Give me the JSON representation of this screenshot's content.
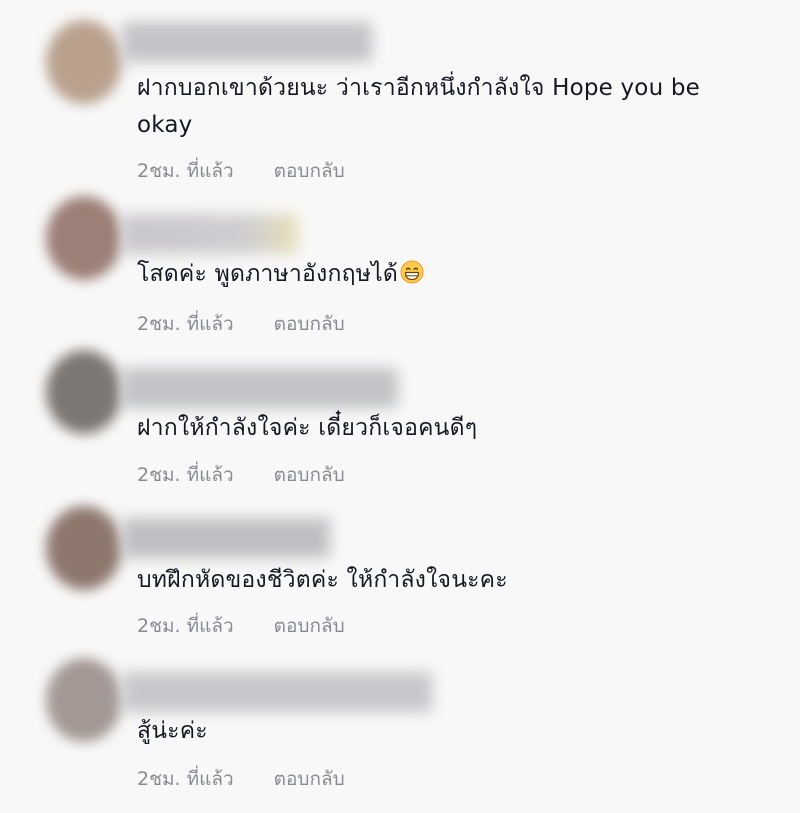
{
  "comments": [
    {
      "text": "ฝากบอกเขาด้วยนะ ว่าเราอีกหนึ่งกำลังใจ Hope you be okay",
      "time": "2ชม. ที่แล้ว",
      "reply": "ตอบกลับ",
      "avatar_color": "#b9a18e",
      "name_color": "#c4c4c8"
    },
    {
      "text": "โสดค่ะ พูดภาษาอังกฤษได้",
      "emoji": "grinning-face-emoji",
      "time": "2ชม. ที่แล้ว",
      "reply": "ตอบกลับ",
      "avatar_color": "#9c7f76",
      "name_color": "#c9c7cc"
    },
    {
      "text": "ฝากให้กำลังใจค่ะ เดี๋ยวก็เจอคนดีๆ",
      "time": "2ชม. ที่แล้ว",
      "reply": "ตอบกลับ",
      "avatar_color": "#7e7874",
      "name_color": "#c2c3c6"
    },
    {
      "text": "บทฝึกหัดของชีวิตค่ะ ให้กำลังใจนะคะ",
      "time": "2ชม. ที่แล้ว",
      "reply": "ตอบกลับ",
      "avatar_color": "#8e786d",
      "name_color": "#c0bfc3"
    },
    {
      "text": "สู้น่ะค่ะ",
      "time": "2ชม. ที่แล้ว",
      "reply": "ตอบกลับ",
      "avatar_color": "#a39894",
      "name_color": "#c7c7cb"
    }
  ]
}
